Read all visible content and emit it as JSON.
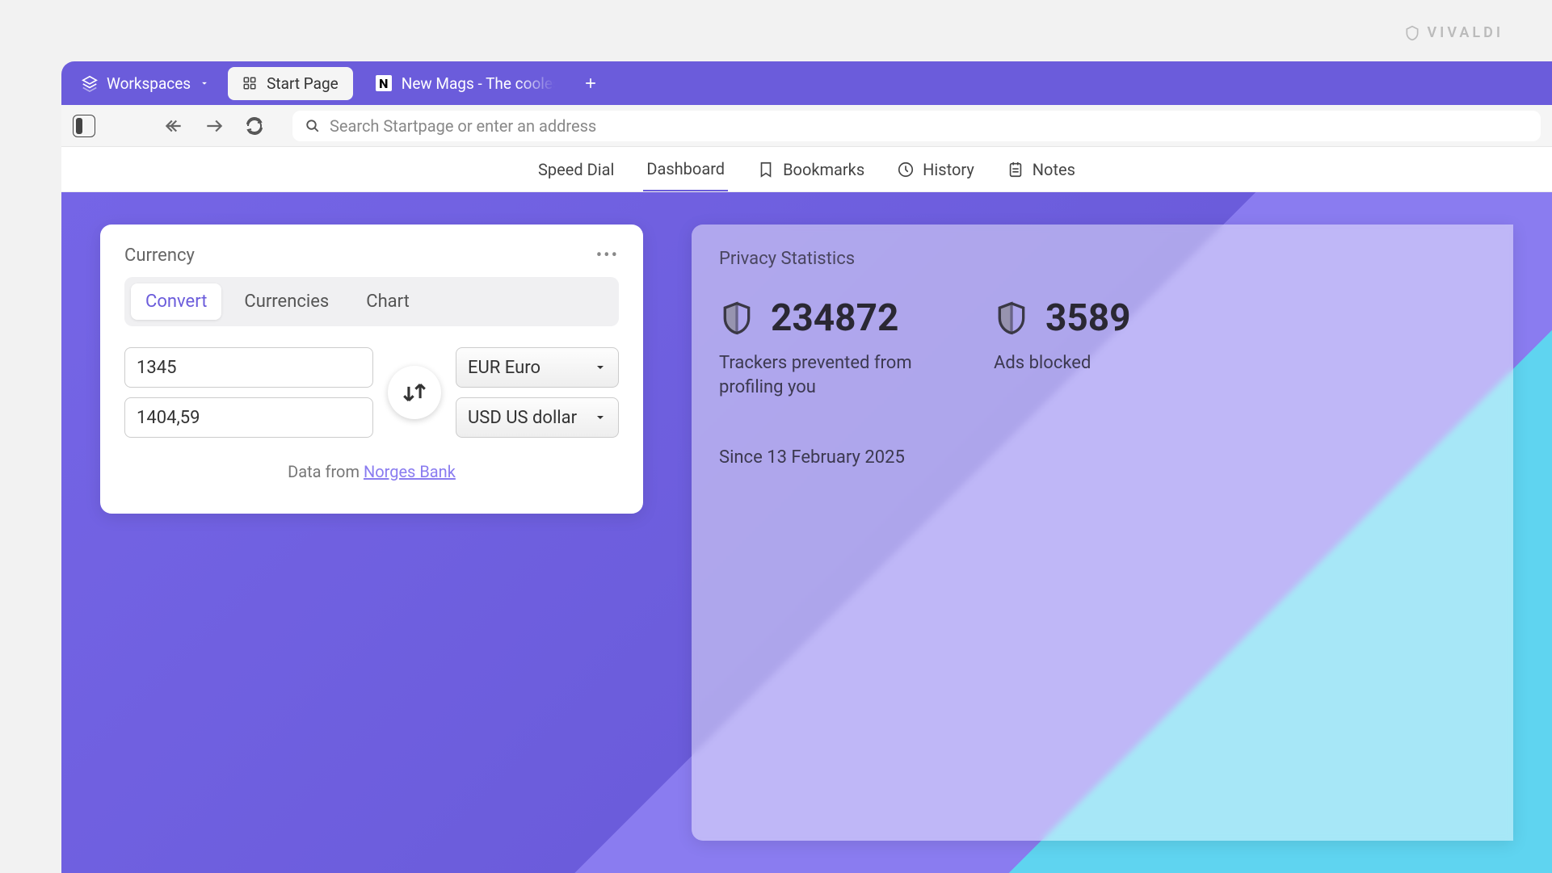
{
  "brand": {
    "name": "VIVALDI"
  },
  "tabbar": {
    "workspaces_label": "Workspaces",
    "tabs": [
      {
        "label": "Start Page",
        "active": true
      },
      {
        "label": "New Mags - The coolest a",
        "active": false
      }
    ]
  },
  "toolbar": {
    "address_placeholder": "Search Startpage or enter an address"
  },
  "subnav": {
    "items": [
      {
        "label": "Speed Dial",
        "icon": null
      },
      {
        "label": "Dashboard",
        "icon": null,
        "active": true
      },
      {
        "label": "Bookmarks",
        "icon": "bookmark"
      },
      {
        "label": "History",
        "icon": "history"
      },
      {
        "label": "Notes",
        "icon": "notes"
      }
    ]
  },
  "currency_widget": {
    "title": "Currency",
    "tabs": [
      "Convert",
      "Currencies",
      "Chart"
    ],
    "active_tab": "Convert",
    "amount_from": "1345",
    "amount_to": "1404,59",
    "currency_from": "EUR Euro",
    "currency_to": "USD US dollar",
    "source_prefix": "Data from ",
    "source_link": "Norges Bank"
  },
  "privacy_widget": {
    "title": "Privacy Statistics",
    "trackers_value": "234872",
    "trackers_label": "Trackers prevented from profiling you",
    "ads_value": "3589",
    "ads_label": "Ads blocked",
    "since": "Since 13 February 2025"
  }
}
